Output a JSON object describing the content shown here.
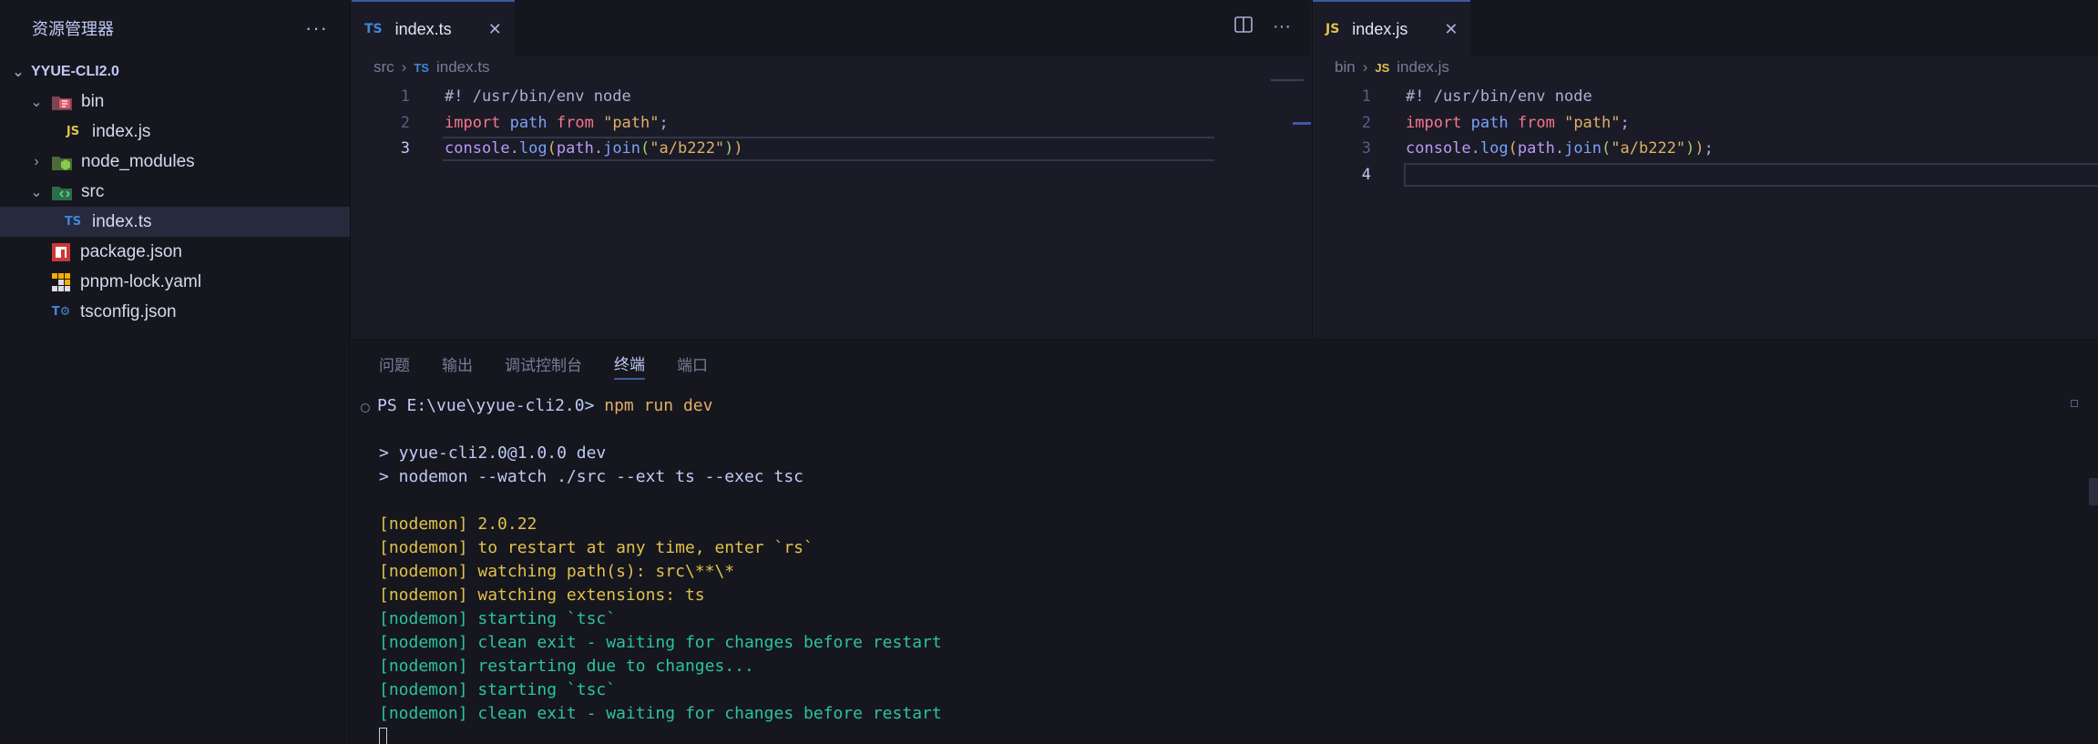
{
  "sidebar": {
    "title": "资源管理器",
    "more_icon": "more-icon",
    "root": "YYUE-CLI2.0",
    "items": [
      {
        "label": "bin",
        "type": "folder",
        "expanded": true
      },
      {
        "label": "index.js",
        "type": "js"
      },
      {
        "label": "node_modules",
        "type": "folder",
        "expanded": false
      },
      {
        "label": "src",
        "type": "folder",
        "expanded": true
      },
      {
        "label": "index.ts",
        "type": "ts",
        "selected": true
      },
      {
        "label": "package.json",
        "type": "npm"
      },
      {
        "label": "pnpm-lock.yaml",
        "type": "pnpm"
      },
      {
        "label": "tsconfig.json",
        "type": "tsconfig"
      }
    ]
  },
  "editor_left": {
    "tab": {
      "badge": "TS",
      "name": "index.ts"
    },
    "breadcrumb": {
      "folder": "src",
      "badge": "TS",
      "file": "index.ts"
    },
    "line_numbers": [
      "1",
      "2",
      "3"
    ],
    "lines": [
      "#! /usr/bin/env node",
      "import path from \"path\";",
      "console.log(path.join(\"a/b222\"))"
    ]
  },
  "editor_right": {
    "tab": {
      "badge": "JS",
      "name": "index.js"
    },
    "breadcrumb": {
      "folder": "bin",
      "badge": "JS",
      "file": "index.js"
    },
    "line_numbers": [
      "1",
      "2",
      "3",
      "4"
    ],
    "lines": [
      "#! /usr/bin/env node",
      "import path from \"path\";",
      "console.log(path.join(\"a/b222\"));",
      ""
    ]
  },
  "panel": {
    "tabs": [
      "问题",
      "输出",
      "调试控制台",
      "终端",
      "端口"
    ],
    "active_tab": "终端",
    "terminal": {
      "prompt": "PS E:\\vue\\yyue-cli2.0> ",
      "command": "npm run dev",
      "lines": [
        "> yyue-cli2.0@1.0.0 dev",
        "> nodemon --watch ./src --ext ts --exec tsc",
        "[nodemon] 2.0.22",
        "[nodemon] to restart at any time, enter `rs`",
        "[nodemon] watching path(s): src\\**\\*",
        "[nodemon] watching extensions: ts",
        "[nodemon] starting `tsc`",
        "[nodemon] clean exit - waiting for changes before restart",
        "[nodemon] restarting due to changes...",
        "[nodemon] starting `tsc`",
        "[nodemon] clean exit - waiting for changes before restart"
      ]
    }
  },
  "colors": {
    "accent": "#3d59a1",
    "terminal_yellow": "#e0c24a",
    "terminal_green": "#2ac3a2"
  }
}
